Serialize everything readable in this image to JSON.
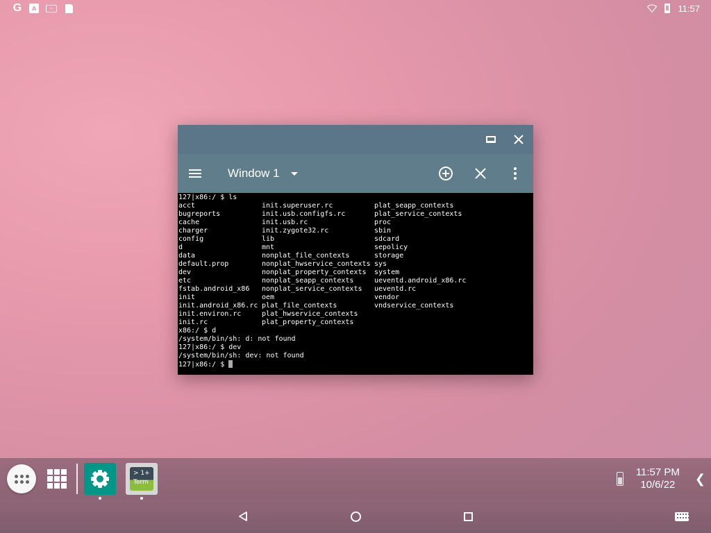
{
  "status_bar": {
    "left_icons": [
      "google-icon",
      "download-notification-icon",
      "fps-notification-icon",
      "sd-card-icon"
    ],
    "right_icons": [
      "wifi-icon",
      "battery-icon"
    ],
    "time": "11:57"
  },
  "window": {
    "caption_buttons": [
      "restore-icon",
      "close-icon"
    ],
    "toolbar": {
      "menu_icon": "hamburger-icon",
      "title": "Window 1",
      "actions": [
        "add-circle-icon",
        "close-icon",
        "more-vert-icon"
      ]
    },
    "terminal": {
      "prompt_ls": "127|x86:/ $ ls",
      "ls_rows": [
        [
          "acct",
          "init.superuser.rc",
          "plat_seapp_contexts"
        ],
        [
          "bugreports",
          "init.usb.configfs.rc",
          "plat_service_contexts"
        ],
        [
          "cache",
          "init.usb.rc",
          "proc"
        ],
        [
          "charger",
          "init.zygote32.rc",
          "sbin"
        ],
        [
          "config",
          "lib",
          "sdcard"
        ],
        [
          "d",
          "mnt",
          "sepolicy"
        ],
        [
          "data",
          "nonplat_file_contexts",
          "storage"
        ],
        [
          "default.prop",
          "nonplat_hwservice_contexts",
          "sys"
        ],
        [
          "dev",
          "nonplat_property_contexts",
          "system"
        ],
        [
          "etc",
          "nonplat_seapp_contexts",
          "ueventd.android_x86.rc"
        ],
        [
          "fstab.android_x86",
          "nonplat_service_contexts",
          "ueventd.rc"
        ],
        [
          "init",
          "oem",
          "vendor"
        ],
        [
          "init.android_x86.rc",
          "plat_file_contexts",
          "vndservice_contexts"
        ],
        [
          "init.environ.rc",
          "plat_hwservice_contexts",
          ""
        ],
        [
          "init.rc",
          "plat_property_contexts",
          ""
        ]
      ],
      "after_lines": [
        "x86:/ $ d",
        "/system/bin/sh: d: not found",
        "127|x86:/ $ dev",
        "/system/bin/sh: dev: not found"
      ],
      "current_prompt": "127|x86:/ $ "
    }
  },
  "taskbar": {
    "pinned_apps": [
      {
        "name": "Settings",
        "icon": "gear-icon"
      },
      {
        "name": "Terminal",
        "icon_text_top": "> 1+",
        "icon_text_bottom": "Term"
      }
    ],
    "clock_time": "11:57 PM",
    "clock_date": "10/6/22",
    "collapse_glyph": "❮"
  },
  "nav_bar": {
    "buttons": [
      "back-icon",
      "home-icon",
      "recents-icon",
      "keyboard-icon"
    ]
  }
}
